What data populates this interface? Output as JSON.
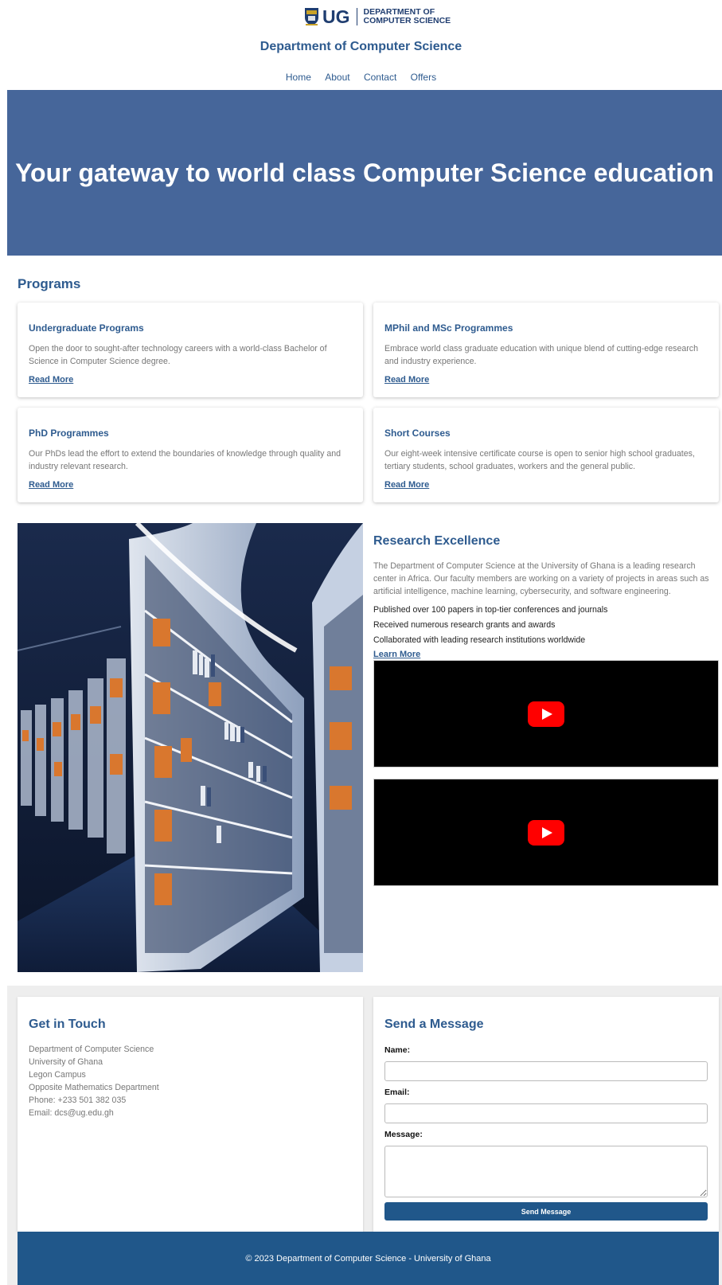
{
  "header": {
    "logo_text": "UG",
    "logo_dept_line1": "DEPARTMENT OF",
    "logo_dept_line2": "COMPUTER SCIENCE",
    "title": "Department of Computer Science",
    "nav": [
      {
        "label": "Home"
      },
      {
        "label": "About"
      },
      {
        "label": "Contact"
      },
      {
        "label": "Offers"
      }
    ]
  },
  "hero": {
    "headline": "Your gateway to world class Computer Science education",
    "background": "#46669a"
  },
  "programs": {
    "title": "Programs",
    "cards": [
      {
        "title": "Undergraduate Programs",
        "text": "Open the door to sought-after technology careers with a world-class Bachelor of Science in Computer Science degree.",
        "link": "Read More"
      },
      {
        "title": "MPhil and MSc Programmes",
        "text": "Embrace world class graduate education with unique blend of cutting-edge research and industry experience.",
        "link": "Read More"
      },
      {
        "title": "PhD Programmes",
        "text": "Our PhDs lead the effort to extend the boundaries of knowledge through quality and industry relevant research.",
        "link": "Read More"
      },
      {
        "title": "Short Courses",
        "text": "Our eight-week intensive certificate course is open to senior high school graduates, tertiary students, school graduates, workers and the general public.",
        "link": "Read More"
      }
    ]
  },
  "research": {
    "title": "Research Excellence",
    "description": "The Department of Computer Science at the University of Ghana is a leading research center in Africa. Our faculty members are working on a variety of projects in areas such as artificial intelligence, machine learning, cybersecurity, and software engineering.",
    "highlights": [
      "Published over 100 papers in top-tier conferences and journals",
      "Received numerous research grants and awards",
      "Collaborated with leading research institutions worldwide"
    ],
    "link": "Learn More",
    "videos": [
      "youtube-embed",
      "youtube-embed"
    ]
  },
  "contact": {
    "title": "Get in Touch",
    "address_lines": [
      "Department of Computer Science",
      "University of Ghana",
      "Legon Campus",
      "Opposite Mathematics Department",
      "Phone: +233 501 382 035",
      "Email: dcs@ug.edu.gh"
    ]
  },
  "form": {
    "title": "Send a Message",
    "name_label": "Name:",
    "name_value": "",
    "email_label": "Email:",
    "email_value": "",
    "message_label": "Message:",
    "message_value": "",
    "submit_label": "Send Message"
  },
  "footer": {
    "text": "© 2023 Department of Computer Science - University of Ghana"
  },
  "colors": {
    "accent": "#2e5b8f",
    "footer": "#20578a",
    "youtube_red": "#ff0000"
  }
}
